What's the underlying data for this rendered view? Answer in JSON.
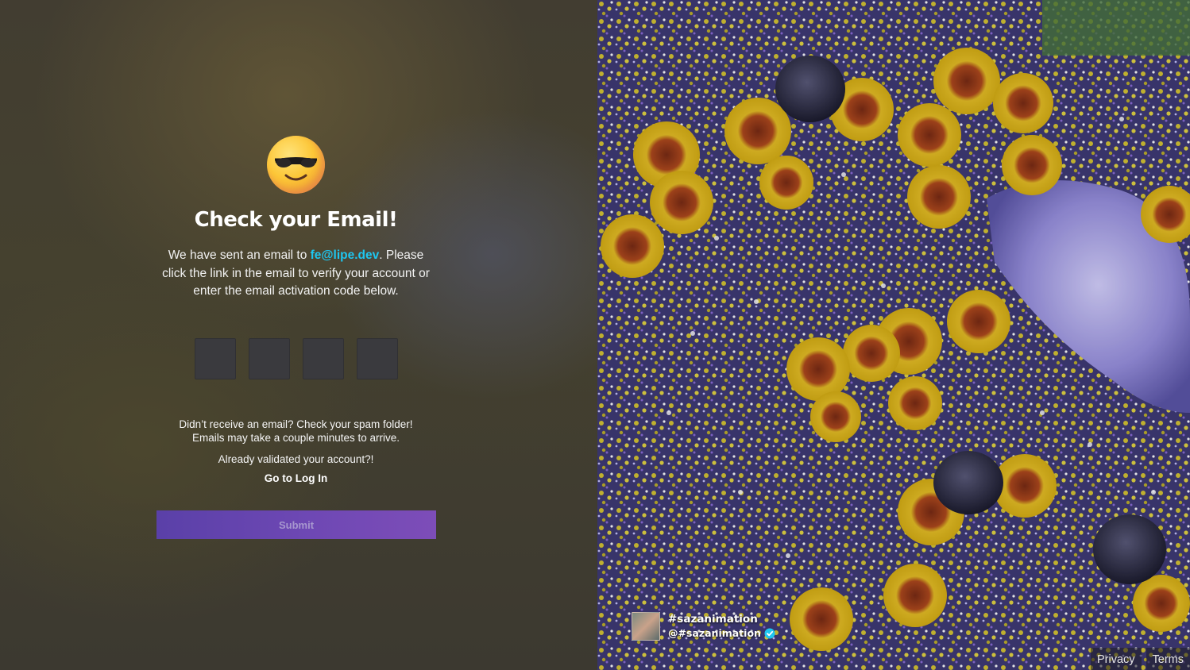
{
  "verify": {
    "emoji_icon": "smiling-face-with-sunglasses",
    "title": "Check your Email!",
    "desc_before": "We have sent an email to ",
    "email": "fe@lipe.dev",
    "desc_after": ". Please click the link in the email to verify your account or enter the email activation code below.",
    "code_values": [
      "",
      "",
      "",
      ""
    ],
    "spam_note_line1": "Didn’t receive an email? Check your spam folder!",
    "spam_note_line2": "Emails may take a couple minutes to arrive.",
    "validated_note": "Already validated your account?!",
    "login_link": "Go to Log In",
    "submit_label": "Submit",
    "accent_color": "#1ec6f0",
    "button_color": "#6a46b0"
  },
  "artwork": {
    "name": "#sazanimation",
    "handle": "@#sazanimation",
    "verified_icon": "verified-badge-icon"
  },
  "footer": {
    "privacy": "Privacy",
    "terms": "Terms"
  }
}
